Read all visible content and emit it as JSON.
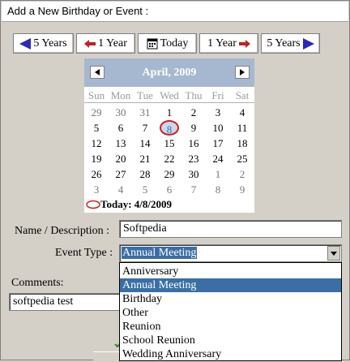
{
  "window": {
    "title": "Add a New Birthday or Event :"
  },
  "nav": {
    "back5": "5 Years",
    "back1": "1 Year",
    "today": "Today",
    "fwd1": "1 Year",
    "fwd5": "5 Years"
  },
  "calendar": {
    "month_title": "April, 2009",
    "days_of_week": [
      "Sun",
      "Mon",
      "Tue",
      "Wed",
      "Thu",
      "Fri",
      "Sat"
    ],
    "weeks": [
      [
        "29",
        "30",
        "31",
        "1",
        "2",
        "3",
        "4"
      ],
      [
        "5",
        "6",
        "7",
        "8",
        "9",
        "10",
        "11"
      ],
      [
        "12",
        "13",
        "14",
        "15",
        "16",
        "17",
        "18"
      ],
      [
        "19",
        "20",
        "21",
        "22",
        "23",
        "24",
        "25"
      ],
      [
        "26",
        "27",
        "28",
        "29",
        "30",
        "1",
        "2"
      ],
      [
        "3",
        "4",
        "5",
        "6",
        "7",
        "8",
        "9"
      ]
    ],
    "selected_day": "8",
    "today_label": "Today: 4/8/2009"
  },
  "form": {
    "name_label": "Name / Description :",
    "name_value": "Softpedia",
    "event_type_label": "Event Type :",
    "event_type_value": "Annual Meeting",
    "comments_label": "Comments:",
    "comments_value": "softpedia test"
  },
  "event_options": [
    "Anniversary",
    "Annual Meeting",
    "Birthday",
    "Other",
    "Reunion",
    "School Reunion",
    "Wedding Anniversary"
  ],
  "colors": {
    "calendar_header": "#a5b8d0",
    "selection": "#3a6ea5",
    "today_marker": "#d02020",
    "nav_arrow_blue": "#2a2ab8",
    "nav_arrow_red": "#c02020"
  }
}
